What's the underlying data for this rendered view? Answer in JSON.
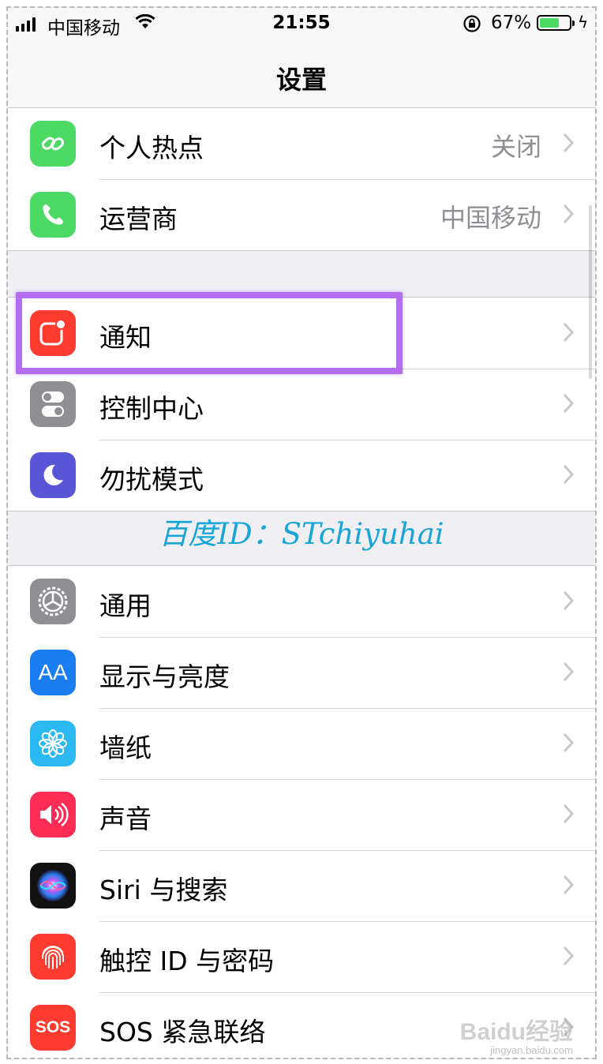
{
  "status_bar": {
    "carrier": "中国移动",
    "time": "21:55",
    "battery_percent": "67%",
    "battery_level": 0.67,
    "battery_color": "#4cd964"
  },
  "nav": {
    "title": "设置"
  },
  "groups": [
    {
      "rows": [
        {
          "label": "个人热点",
          "value": "关闭",
          "icon": "hotspot-icon",
          "icon_color": "#4cd964"
        },
        {
          "label": "运营商",
          "value": "中国移动",
          "icon": "phone-icon",
          "icon_color": "#4cd964"
        }
      ]
    },
    {
      "rows": [
        {
          "label": "通知",
          "icon": "notifications-icon",
          "icon_color": "#ff3b30"
        },
        {
          "label": "控制中心",
          "icon": "control-center-icon",
          "icon_color": "#8e8e93"
        },
        {
          "label": "勿扰模式",
          "icon": "moon-icon",
          "icon_color": "#5856d6"
        }
      ]
    },
    {
      "rows": [
        {
          "label": "通用",
          "icon": "gear-icon",
          "icon_color": "#8e8e93"
        },
        {
          "label": "显示与亮度",
          "icon": "display-icon",
          "icon_color": "#007aff",
          "icon_text": "AA"
        },
        {
          "label": "墙纸",
          "icon": "wallpaper-icon",
          "icon_color": "#34aadc"
        },
        {
          "label": "声音",
          "icon": "sound-icon",
          "icon_color": "#ff2d55"
        },
        {
          "label": "Siri 与搜索",
          "icon": "siri-icon",
          "icon_color": "#1c1c3c"
        },
        {
          "label": "触控 ID 与密码",
          "icon": "fingerprint-icon",
          "icon_color": "#ff3b30"
        },
        {
          "label": "SOS 紧急联络",
          "icon": "sos-icon",
          "icon_color": "#ff3b30",
          "icon_text": "SOS"
        }
      ]
    }
  ],
  "watermark": "百度ID：STchiyuhai",
  "baidu_logo": "Baidu经验",
  "baidu_url": "jingyan.baidu.com",
  "highlight_color": "#b36ef0"
}
